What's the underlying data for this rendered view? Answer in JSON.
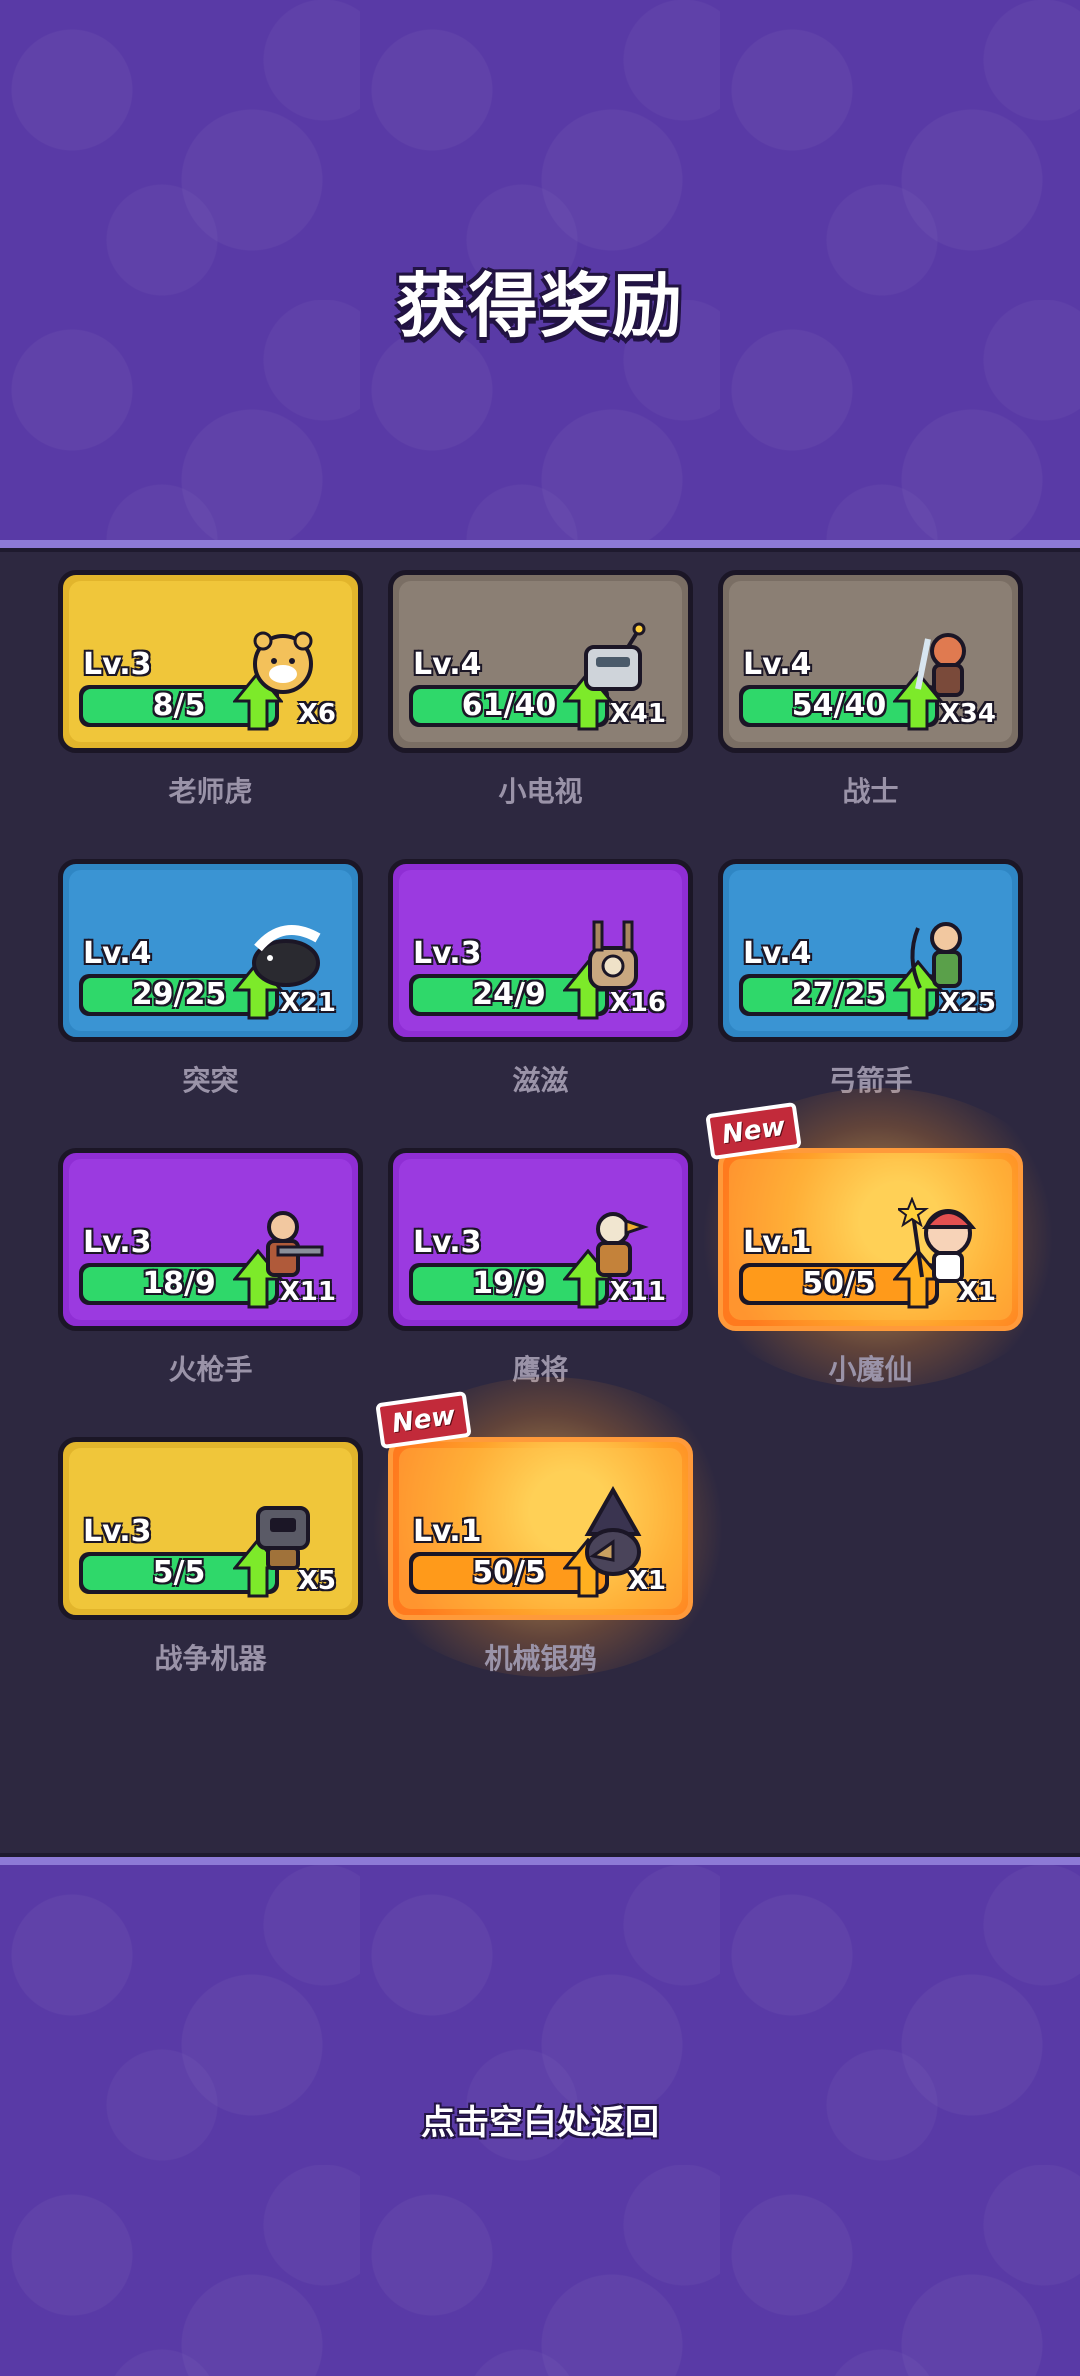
{
  "title": "获得奖励",
  "back_hint": "点击空白处返回",
  "new_badge": "New",
  "cards": [
    {
      "name": "老师虎",
      "level": "Lv.3",
      "progress": "8/5",
      "progress_ratio": 1.0,
      "count": "X6",
      "rarity": "gold",
      "icon": "tiger-icon",
      "is_new": false
    },
    {
      "name": "小电视",
      "level": "Lv.4",
      "progress": "61/40",
      "progress_ratio": 1.0,
      "count": "X41",
      "rarity": "gray",
      "icon": "tv-robot-icon",
      "is_new": false
    },
    {
      "name": "战士",
      "level": "Lv.4",
      "progress": "54/40",
      "progress_ratio": 1.0,
      "count": "X34",
      "rarity": "gray",
      "icon": "warrior-icon",
      "is_new": false
    },
    {
      "name": "突突",
      "level": "Lv.4",
      "progress": "29/25",
      "progress_ratio": 1.0,
      "count": "X21",
      "rarity": "blue",
      "icon": "skunk-icon",
      "is_new": false
    },
    {
      "name": "滋滋",
      "level": "Lv.3",
      "progress": "24/9",
      "progress_ratio": 1.0,
      "count": "X16",
      "rarity": "purple",
      "icon": "tesla-robot-icon",
      "is_new": false
    },
    {
      "name": "弓箭手",
      "level": "Lv.4",
      "progress": "27/25",
      "progress_ratio": 1.0,
      "count": "X25",
      "rarity": "blue",
      "icon": "archer-icon",
      "is_new": false
    },
    {
      "name": "火枪手",
      "level": "Lv.3",
      "progress": "18/9",
      "progress_ratio": 1.0,
      "count": "X11",
      "rarity": "purple",
      "icon": "gunner-icon",
      "is_new": false
    },
    {
      "name": "鹰将",
      "level": "Lv.3",
      "progress": "19/9",
      "progress_ratio": 1.0,
      "count": "X11",
      "rarity": "purple",
      "icon": "eagle-general-icon",
      "is_new": false
    },
    {
      "name": "小魔仙",
      "level": "Lv.1",
      "progress": "50/5",
      "progress_ratio": 1.0,
      "count": "X1",
      "rarity": "orange",
      "icon": "fairy-icon",
      "is_new": true
    },
    {
      "name": "战争机器",
      "level": "Lv.3",
      "progress": "5/5",
      "progress_ratio": 1.0,
      "count": "X5",
      "rarity": "gold",
      "icon": "war-machine-icon",
      "is_new": false
    },
    {
      "name": "机械银鸦",
      "level": "Lv.1",
      "progress": "50/5",
      "progress_ratio": 1.0,
      "count": "X1",
      "rarity": "orange",
      "icon": "mech-crow-icon",
      "is_new": true
    }
  ],
  "colors": {
    "background": "#5a3aa8",
    "panel": "#2d2840",
    "bar_green": "#2fd86a",
    "bar_orange": "#ff9a1a",
    "arrow_green": "#7dea2a",
    "arrow_orange": "#ffb020"
  }
}
